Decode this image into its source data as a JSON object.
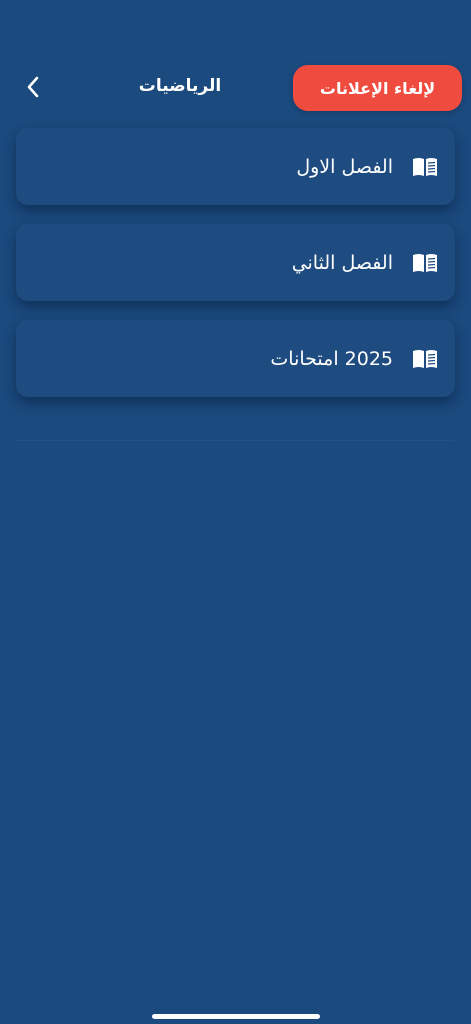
{
  "header": {
    "title": "الرياضيات",
    "ads_button_label": "لإلغاء الإعلانات",
    "back_icon": "chevron-left-icon"
  },
  "items": [
    {
      "label": "الفصل الاول",
      "icon": "book-icon"
    },
    {
      "label": "الفصل الثاني",
      "icon": "book-icon"
    },
    {
      "label": "2025 امتحانات",
      "icon": "book-icon"
    }
  ],
  "colors": {
    "background": "#1b4a7e",
    "card": "#1f4c80",
    "accent": "#f04b3f",
    "text": "#ffffff"
  }
}
